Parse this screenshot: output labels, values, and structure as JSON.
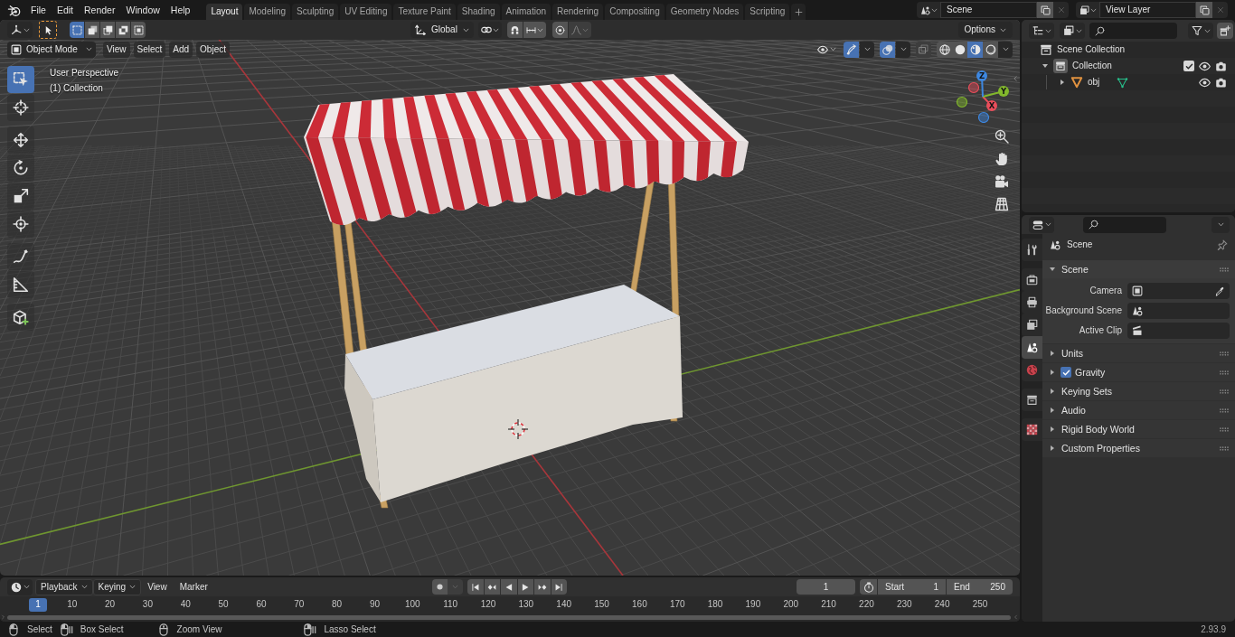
{
  "top_bar": {
    "menus": [
      "File",
      "Edit",
      "Render",
      "Window",
      "Help"
    ],
    "workspaces": [
      {
        "label": "Layout",
        "selected": true
      },
      {
        "label": "Modeling",
        "selected": false
      },
      {
        "label": "Sculpting",
        "selected": false
      },
      {
        "label": "UV Editing",
        "selected": false
      },
      {
        "label": "Texture Paint",
        "selected": false
      },
      {
        "label": "Shading",
        "selected": false
      },
      {
        "label": "Animation",
        "selected": false
      },
      {
        "label": "Rendering",
        "selected": false
      },
      {
        "label": "Compositing",
        "selected": false
      },
      {
        "label": "Geometry Nodes",
        "selected": false
      },
      {
        "label": "Scripting",
        "selected": false
      }
    ],
    "scene": "Scene",
    "view_layer": "View Layer"
  },
  "viewport": {
    "tool_header": {
      "select_modes": [
        {
          "kind": "set",
          "selected": true
        },
        {
          "kind": "extend",
          "selected": false
        },
        {
          "kind": "subtract",
          "selected": false
        },
        {
          "kind": "difference",
          "selected": false
        },
        {
          "kind": "intersect",
          "selected": false
        }
      ],
      "orientation": "Global",
      "snap": {
        "on": false
      },
      "proportional": {
        "on": false
      },
      "options": "Options"
    },
    "header": {
      "mode": "Object Mode",
      "menus": [
        "View",
        "Select",
        "Add",
        "Object"
      ],
      "gizmos": {
        "on": true
      },
      "overlays": {
        "on": true
      },
      "xray": {
        "on": false
      },
      "shading": [
        {
          "kind": "wireframe",
          "selected": false
        },
        {
          "kind": "solid",
          "selected": false
        },
        {
          "kind": "material",
          "selected": true
        },
        {
          "kind": "rendered",
          "selected": false
        }
      ]
    },
    "toolbar": [
      [
        {
          "kind": "select_box",
          "selected": true
        },
        {
          "kind": "cursor",
          "selected": false
        }
      ],
      [
        {
          "kind": "move",
          "selected": false
        },
        {
          "kind": "rotate",
          "selected": false
        },
        {
          "kind": "scale",
          "selected": false
        },
        {
          "kind": "transform",
          "selected": false
        }
      ],
      [
        {
          "kind": "annotate",
          "selected": false
        },
        {
          "kind": "measure",
          "selected": false
        }
      ],
      [
        {
          "kind": "add_cube",
          "selected": false
        }
      ]
    ],
    "info": [
      "User Perspective",
      "(1) Collection"
    ],
    "navigation_gizmo": {
      "axes": [
        {
          "label": "X",
          "color": "#e84d5a"
        },
        {
          "label": "Y",
          "color": "#82b82c"
        },
        {
          "label": "Z",
          "color": "#3d87e0"
        }
      ]
    }
  },
  "outliner": {
    "tree": [
      {
        "kind": "scene_collection",
        "label": "Scene Collection",
        "active": false,
        "children": [
          {
            "kind": "collection",
            "label": "Collection",
            "active": true,
            "expanded": true,
            "checked": true,
            "visible": true,
            "renderable": true,
            "children": [
              {
                "kind": "object",
                "label": "obj",
                "active": false,
                "expanded": false,
                "visible": true,
                "renderable": true
              }
            ]
          }
        ]
      }
    ]
  },
  "properties": {
    "tab_groups": [
      [
        {
          "kind": "tool",
          "selected": false
        }
      ],
      [
        {
          "kind": "render",
          "selected": false
        },
        {
          "kind": "output",
          "selected": false
        },
        {
          "kind": "view_layer",
          "selected": false
        },
        {
          "kind": "scene",
          "selected": true
        },
        {
          "kind": "world",
          "selected": false
        }
      ],
      [
        {
          "kind": "collection",
          "selected": false
        }
      ],
      [
        {
          "kind": "texture",
          "selected": false
        }
      ]
    ],
    "context": "Scene",
    "panels": [
      {
        "kind": "plain",
        "title": "Scene",
        "expanded": true,
        "fields": [
          {
            "kind": "object",
            "label": "Camera"
          },
          {
            "kind": "scene",
            "label": "Background Scene"
          },
          {
            "kind": "clip",
            "label": "Active Clip"
          }
        ]
      },
      {
        "kind": "plain",
        "title": "Units",
        "expanded": false
      },
      {
        "kind": "toggle",
        "title": "Gravity",
        "expanded": false,
        "checked": true
      },
      {
        "kind": "plain",
        "title": "Keying Sets",
        "expanded": false
      },
      {
        "kind": "plain",
        "title": "Audio",
        "expanded": false
      },
      {
        "kind": "plain",
        "title": "Rigid Body World",
        "expanded": false
      },
      {
        "kind": "plain",
        "title": "Custom Properties",
        "expanded": false
      }
    ]
  },
  "timeline": {
    "menus": [
      {
        "label": "Playback",
        "dropdown": true
      },
      {
        "label": "Keying",
        "dropdown": true
      },
      {
        "label": "View",
        "dropdown": false
      },
      {
        "label": "Marker",
        "dropdown": false
      }
    ],
    "auto_keying": {
      "on": false
    },
    "current_frame": "1",
    "start": {
      "label": "Start",
      "value": "1"
    },
    "end": {
      "label": "End",
      "value": "250"
    },
    "ruler": {
      "current": "1",
      "labels": [
        "10",
        "20",
        "30",
        "40",
        "50",
        "60",
        "70",
        "80",
        "90",
        "100",
        "110",
        "120",
        "130",
        "140",
        "150",
        "160",
        "170",
        "180",
        "190",
        "200",
        "210",
        "220",
        "230",
        "240",
        "250"
      ]
    }
  },
  "status_bar": {
    "hints": [
      {
        "kind": "left_click",
        "label": "Select"
      },
      {
        "kind": "left_drag",
        "label": "Box Select"
      },
      {
        "kind": "middle",
        "label": "Zoom View"
      },
      {
        "kind": "right_drag",
        "label": "Lasso Select"
      }
    ],
    "version": "2.93.9"
  }
}
